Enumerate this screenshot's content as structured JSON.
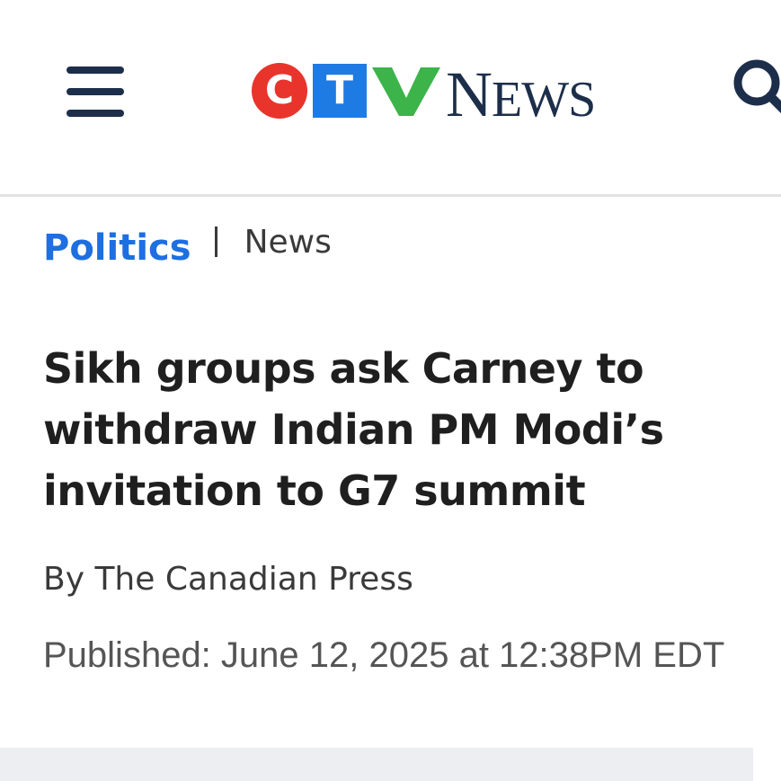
{
  "header": {
    "menu_icon": "hamburger-menu-icon",
    "logo": {
      "letters": [
        "C",
        "T",
        "V"
      ],
      "wordmark_first": "N",
      "wordmark_rest": "EWS",
      "colors": {
        "c_circle": "#e8342b",
        "t_square": "#1e7be3",
        "v_check": "#3cb44a",
        "wordmark": "#1c2e4a"
      }
    },
    "search_icon": "search-icon"
  },
  "breadcrumb": {
    "section": "Politics",
    "subsection": "News"
  },
  "article": {
    "headline": "Sikh groups ask Carney to withdraw Indian PM Modi’s invitation to G7 summit",
    "byline": "By The Canadian Press",
    "published": "Published: June 12, 2025 at 12:38PM EDT"
  },
  "colors": {
    "accent": "#1e6fe0",
    "navy": "#1c2e4a",
    "divider": "#e2e2e2",
    "ad_background": "#eceef2"
  }
}
